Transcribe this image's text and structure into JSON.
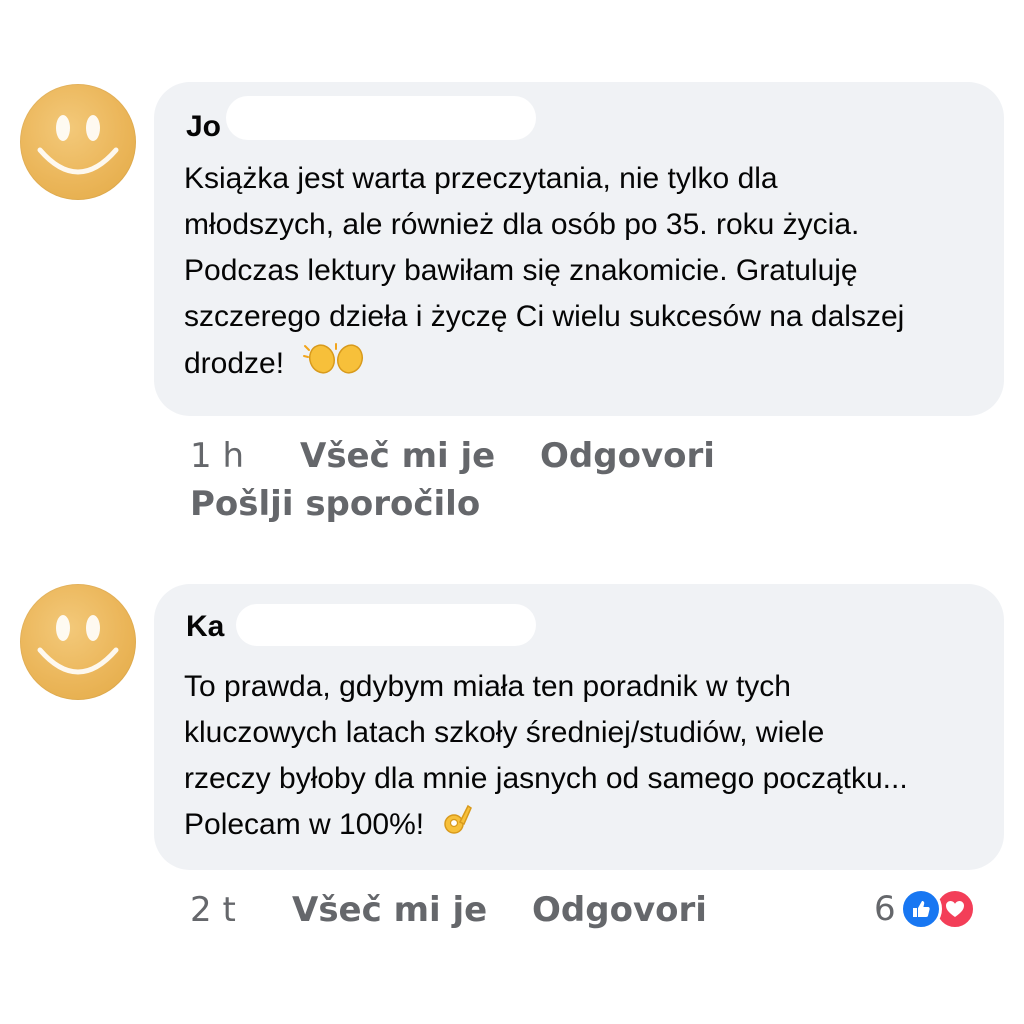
{
  "comments": [
    {
      "author": "Jo",
      "text": "Książka jest warta przeczytania, nie tylko dla\nmłodszych, ale również dla osób po 35. roku życia.\nPodczas lektury bawiłam się znakomicie. Gratuluję\nszczerego dzieła i życzę Ci wielu sukcesów na dalszej\ndrodze! ",
      "emoji": "clapping-hands-icon",
      "time": "1 h",
      "like": "Všeč mi je",
      "reply": "Odgovori",
      "message": "Pošlji sporočilo"
    },
    {
      "author": "Ka",
      "text": "To prawda, gdybym miała ten poradnik w tych\nkluczowych latach szkoły średniej/studiów, wiele\nrzeczy byłoby dla mnie jasnych od samego początku...\nPolecam w 100%! ",
      "emoji": "ok-hand-icon",
      "time": "2 t",
      "like": "Všeč mi je",
      "reply": "Odgovori",
      "reaction_count": "6",
      "reaction_icons": [
        "like-icon",
        "love-icon"
      ]
    }
  ],
  "colors": {
    "bubble": "#f0f2f5",
    "meta_text": "#65676b",
    "like_blue": "#1877f2",
    "love_red": "#f33e58",
    "avatar": "#ebb65a"
  }
}
